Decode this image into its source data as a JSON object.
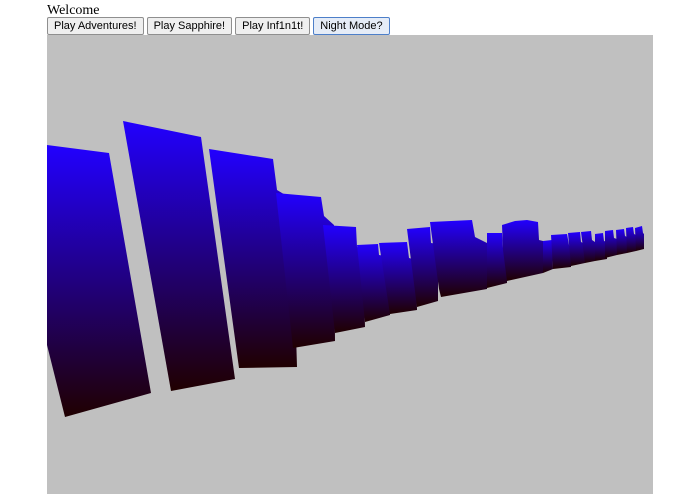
{
  "header": {
    "welcome_text": "Welcome"
  },
  "buttons": [
    {
      "label": "Play Adventures!"
    },
    {
      "label": "Play Sapphire!"
    },
    {
      "label": "Play Inf1n1t!"
    },
    {
      "label": "Night Mode?"
    }
  ],
  "game": {
    "background_color": "#c0c0c0",
    "bar_top_color": "#2200ff",
    "bar_bottom_color": "#200000"
  }
}
